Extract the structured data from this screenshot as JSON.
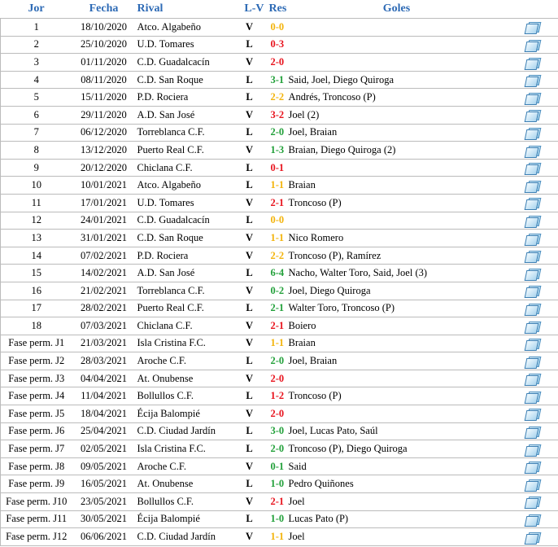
{
  "headers": {
    "jor": "Jor",
    "fecha": "Fecha",
    "rival": "Rival",
    "lv": "L-V",
    "res": "Res",
    "goles": "Goles"
  },
  "rows": [
    {
      "jor": "1",
      "fecha": "18/10/2020",
      "rival": "Atco. Algabeño",
      "lv": "V",
      "res": "0-0",
      "outcome": "E",
      "goles": ""
    },
    {
      "jor": "2",
      "fecha": "25/10/2020",
      "rival": "U.D. Tomares",
      "lv": "L",
      "res": "0-3",
      "outcome": "D",
      "goles": ""
    },
    {
      "jor": "3",
      "fecha": "01/11/2020",
      "rival": "C.D. Guadalcacín",
      "lv": "V",
      "res": "2-0",
      "outcome": "D",
      "goles": ""
    },
    {
      "jor": "4",
      "fecha": "08/11/2020",
      "rival": "C.D. San Roque",
      "lv": "L",
      "res": "3-1",
      "outcome": "V",
      "goles": "Said, Joel, Diego Quiroga"
    },
    {
      "jor": "5",
      "fecha": "15/11/2020",
      "rival": "P.D. Rociera",
      "lv": "L",
      "res": "2-2",
      "outcome": "E",
      "goles": "Andrés, Troncoso (P)"
    },
    {
      "jor": "6",
      "fecha": "29/11/2020",
      "rival": "A.D. San José",
      "lv": "V",
      "res": "3-2",
      "outcome": "D",
      "goles": "Joel (2)"
    },
    {
      "jor": "7",
      "fecha": "06/12/2020",
      "rival": "Torreblanca C.F.",
      "lv": "L",
      "res": "2-0",
      "outcome": "V",
      "goles": "Joel, Braian"
    },
    {
      "jor": "8",
      "fecha": "13/12/2020",
      "rival": "Puerto Real C.F.",
      "lv": "V",
      "res": "1-3",
      "outcome": "V",
      "goles": "Braian, Diego Quiroga (2)"
    },
    {
      "jor": "9",
      "fecha": "20/12/2020",
      "rival": "Chiclana C.F.",
      "lv": "L",
      "res": "0-1",
      "outcome": "D",
      "goles": ""
    },
    {
      "jor": "10",
      "fecha": "10/01/2021",
      "rival": "Atco. Algabeño",
      "lv": "L",
      "res": "1-1",
      "outcome": "E",
      "goles": "Braian"
    },
    {
      "jor": "11",
      "fecha": "17/01/2021",
      "rival": "U.D. Tomares",
      "lv": "V",
      "res": "2-1",
      "outcome": "D",
      "goles": "Troncoso (P)"
    },
    {
      "jor": "12",
      "fecha": "24/01/2021",
      "rival": "C.D. Guadalcacín",
      "lv": "L",
      "res": "0-0",
      "outcome": "E",
      "goles": ""
    },
    {
      "jor": "13",
      "fecha": "31/01/2021",
      "rival": "C.D. San Roque",
      "lv": "V",
      "res": "1-1",
      "outcome": "E",
      "goles": "Nico Romero"
    },
    {
      "jor": "14",
      "fecha": "07/02/2021",
      "rival": "P.D. Rociera",
      "lv": "V",
      "res": "2-2",
      "outcome": "E",
      "goles": "Troncoso (P), Ramírez"
    },
    {
      "jor": "15",
      "fecha": "14/02/2021",
      "rival": "A.D. San José",
      "lv": "L",
      "res": "6-4",
      "outcome": "V",
      "goles": "Nacho, Walter Toro, Said, Joel (3)"
    },
    {
      "jor": "16",
      "fecha": "21/02/2021",
      "rival": "Torreblanca C.F.",
      "lv": "V",
      "res": "0-2",
      "outcome": "V",
      "goles": "Joel, Diego Quiroga"
    },
    {
      "jor": "17",
      "fecha": "28/02/2021",
      "rival": "Puerto Real C.F.",
      "lv": "L",
      "res": "2-1",
      "outcome": "V",
      "goles": "Walter Toro, Troncoso (P)"
    },
    {
      "jor": "18",
      "fecha": "07/03/2021",
      "rival": "Chiclana C.F.",
      "lv": "V",
      "res": "2-1",
      "outcome": "D",
      "goles": "Boiero"
    },
    {
      "jor": "Fase perm. J1",
      "fecha": "21/03/2021",
      "rival": "Isla Cristina F.C.",
      "lv": "V",
      "res": "1-1",
      "outcome": "E",
      "goles": "Braian"
    },
    {
      "jor": "Fase perm. J2",
      "fecha": "28/03/2021",
      "rival": "Aroche C.F.",
      "lv": "L",
      "res": "2-0",
      "outcome": "V",
      "goles": "Joel, Braian"
    },
    {
      "jor": "Fase perm. J3",
      "fecha": "04/04/2021",
      "rival": "At. Onubense",
      "lv": "V",
      "res": "2-0",
      "outcome": "D",
      "goles": ""
    },
    {
      "jor": "Fase perm. J4",
      "fecha": "11/04/2021",
      "rival": "Bollullos C.F.",
      "lv": "L",
      "res": "1-2",
      "outcome": "D",
      "goles": "Troncoso (P)"
    },
    {
      "jor": "Fase perm. J5",
      "fecha": "18/04/2021",
      "rival": "Écija Balompié",
      "lv": "V",
      "res": "2-0",
      "outcome": "D",
      "goles": ""
    },
    {
      "jor": "Fase perm. J6",
      "fecha": "25/04/2021",
      "rival": "C.D. Ciudad Jardín",
      "lv": "L",
      "res": "3-0",
      "outcome": "V",
      "goles": "Joel, Lucas Pato, Saúl"
    },
    {
      "jor": "Fase perm. J7",
      "fecha": "02/05/2021",
      "rival": "Isla Cristina F.C.",
      "lv": "L",
      "res": "2-0",
      "outcome": "V",
      "goles": "Troncoso (P), Diego Quiroga"
    },
    {
      "jor": "Fase perm. J8",
      "fecha": "09/05/2021",
      "rival": "Aroche C.F.",
      "lv": "V",
      "res": "0-1",
      "outcome": "V",
      "goles": "Said"
    },
    {
      "jor": "Fase perm. J9",
      "fecha": "16/05/2021",
      "rival": "At. Onubense",
      "lv": "L",
      "res": "1-0",
      "outcome": "V",
      "goles": "Pedro Quiñones"
    },
    {
      "jor": "Fase perm. J10",
      "fecha": "23/05/2021",
      "rival": "Bollullos C.F.",
      "lv": "V",
      "res": "2-1",
      "outcome": "D",
      "goles": "Joel"
    },
    {
      "jor": "Fase perm. J11",
      "fecha": "30/05/2021",
      "rival": "Écija Balompié",
      "lv": "L",
      "res": "1-0",
      "outcome": "V",
      "goles": "Lucas Pato (P)"
    },
    {
      "jor": "Fase perm. J12",
      "fecha": "06/06/2021",
      "rival": "C.D. Ciudad Jardín",
      "lv": "V",
      "res": "1-1",
      "outcome": "E",
      "goles": "Joel"
    }
  ],
  "row_icon": "match-report-icon",
  "colors": {
    "header": "#2d6ab5",
    "win": "#22a03a",
    "loss": "#e8141e",
    "draw": "#f3b40c",
    "border": "#bbbbbb"
  }
}
